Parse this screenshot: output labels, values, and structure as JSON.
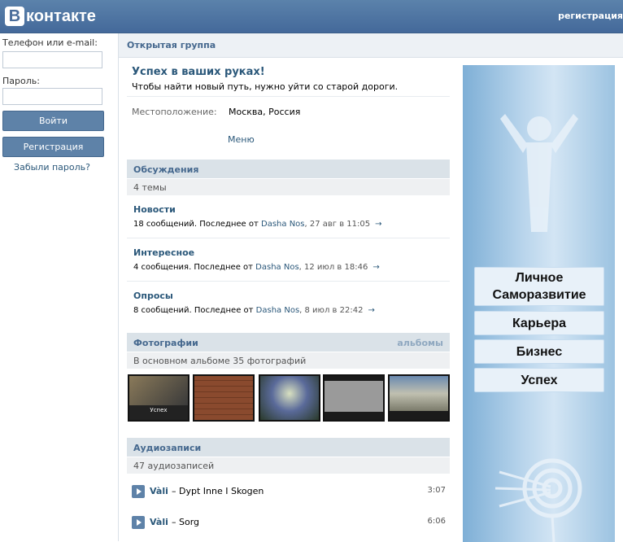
{
  "header": {
    "logo_letter": "В",
    "logo_text": "контакте",
    "register_link": "регистрация"
  },
  "login": {
    "phone_label": "Телефон или e-mail:",
    "password_label": "Пароль:",
    "login_button": "Войти",
    "register_button": "Регистрация",
    "forgot_link": "Забыли пароль?"
  },
  "group": {
    "type_label": "Открытая группа",
    "status_title": "Успех в ваших руках!",
    "status_text": "Чтобы найти новый путь, нужно уйти со старой дороги.",
    "location_label": "Местоположение:",
    "location_value": "Москва, Россия",
    "menu_link": "Меню"
  },
  "discussions": {
    "title": "Обсуждения",
    "count": "4 темы",
    "topics": [
      {
        "title": "Новости",
        "meta": "18 сообщений. Последнее от ",
        "user": "Dasha Nos",
        "date": ", 27 авг в 11:05",
        "arrow": "→"
      },
      {
        "title": "Интересное",
        "meta": "4 сообщения. Последнее от ",
        "user": "Dasha Nos",
        "date": ", 12 июл в 18:46",
        "arrow": "→"
      },
      {
        "title": "Опросы",
        "meta": "8 сообщений. Последнее от ",
        "user": "Dasha Nos",
        "date": ", 8 июл в 22:42",
        "arrow": "→"
      }
    ]
  },
  "photos": {
    "title": "Фотографии",
    "albums_link": "альбомы",
    "subtitle": "В основном альбоме 35 фотографий",
    "thumbs": [
      {
        "caption": "Успех",
        "colors": [
          "#6b5a3e",
          "#2b2b2b"
        ]
      },
      {
        "caption": "",
        "colors": [
          "#8a4a2e",
          "#5e3320"
        ]
      },
      {
        "caption": "",
        "colors": [
          "#3a5a8a",
          "#7a6a40"
        ]
      },
      {
        "caption": "",
        "colors": [
          "#6b6b6b",
          "#3b3b3b"
        ]
      },
      {
        "caption": "",
        "colors": [
          "#8a8a7a",
          "#4a5a3a"
        ]
      }
    ]
  },
  "audio": {
    "title": "Аудиозаписи",
    "count": "47 аудиозаписей",
    "tracks": [
      {
        "artist": "Vàli",
        "sep": " – ",
        "song": "Dypt Inne I Skogen",
        "duration": "3:07"
      },
      {
        "artist": "Vàli",
        "sep": " – ",
        "song": "Sorg",
        "duration": "6:06"
      }
    ]
  },
  "banner": {
    "items": [
      "Личное Саморазвитие",
      "Карьера",
      "Бизнес",
      "Успех"
    ],
    "icons": [
      "person-arms-up-icon",
      "target-arrows-icon"
    ]
  }
}
